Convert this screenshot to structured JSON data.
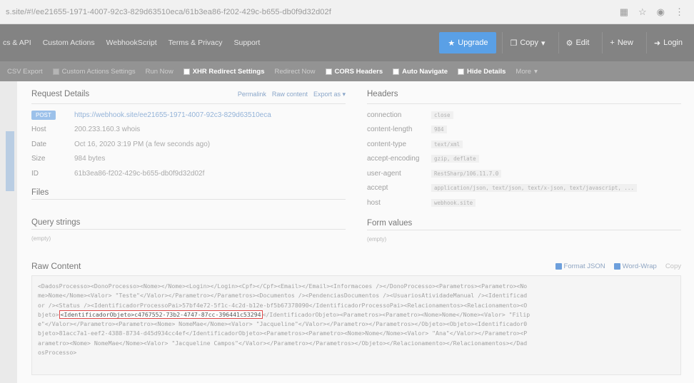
{
  "browser": {
    "url": "s.site/#!/ee21655-1971-4007-92c3-829d63510eca/61b3ea86-f202-429c-b655-db0f9d32d02f"
  },
  "topnav": {
    "links": [
      "cs & API",
      "Custom Actions",
      "WebhookScript",
      "Terms & Privacy",
      "Support"
    ],
    "upgrade_label": "Upgrade",
    "copy_label": "Copy",
    "edit_label": "Edit",
    "new_label": "New",
    "login_label": "Login"
  },
  "toolbar": {
    "items": [
      {
        "label": "CSV Export",
        "on": false
      },
      {
        "label": "Custom Actions Settings",
        "on": false
      },
      {
        "label": "Run Now",
        "on": false
      },
      {
        "label": "XHR Redirect Settings",
        "on": true
      },
      {
        "label": "Redirect Now",
        "on": false
      },
      {
        "label": "CORS Headers",
        "on": true
      },
      {
        "label": "Auto Navigate",
        "on": true
      },
      {
        "label": "Hide Details",
        "on": true
      },
      {
        "label": "More",
        "on": false
      }
    ]
  },
  "request_details": {
    "title": "Request Details",
    "permalink": "Permalink",
    "raw_content": "Raw content",
    "export_as": "Export as",
    "method": "POST",
    "url": "https://webhook.site/ee21655-1971-4007-92c3-829d63510eca",
    "host_label": "Host",
    "host_value": "200.233.160.3 whois",
    "date_label": "Date",
    "date_value": "Oct 16, 2020 3:19 PM (a few seconds ago)",
    "size_label": "Size",
    "size_value": "984 bytes",
    "id_label": "ID",
    "id_value": "61b3ea86-f202-429c-b655-db0f9d32d02f"
  },
  "files": {
    "title": "Files"
  },
  "query_strings": {
    "title": "Query strings",
    "empty": "(empty)"
  },
  "headers": {
    "title": "Headers",
    "rows": [
      {
        "key": "connection",
        "value": "close"
      },
      {
        "key": "content-length",
        "value": "984"
      },
      {
        "key": "content-type",
        "value": "text/xml"
      },
      {
        "key": "accept-encoding",
        "value": "gzip, deflate"
      },
      {
        "key": "user-agent",
        "value": "RestSharp/106.11.7.0"
      },
      {
        "key": "accept",
        "value": "application/json, text/json, text/x-json, text/javascript, ..."
      },
      {
        "key": "host",
        "value": "webhook.site"
      }
    ]
  },
  "form_values": {
    "title": "Form values",
    "empty": "(empty)"
  },
  "raw": {
    "title": "Raw Content",
    "format_json": "Format JSON",
    "word_wrap": "Word-Wrap",
    "copy": "Copy",
    "lines": [
      "<DadosProcesso><DonoProcesso><Nome></Nome><Login></Login><Cpf></Cpf><Email></Email><Informacoes /></DonoProcesso><Parametros><Parametro><No",
      "me>Nome</Nome><Valor> \"Teste\"</Valor></Parametro></Parametros><Documentos /><PendenciasDocumentos /><UsuariosAtividadeManual /><Identificad",
      "or /><Status /><IdentificadorProcessoPai>57bf4e72-5f1c-4c2d-b12e-bf5b67378090</IdentificadorProcessoPai><Relacionamentos><Relacionamento><O",
      "bjeto>",
      "e\"</Valor></Parametro><Parametro><Nome> NomeMae</Nome><Valor> \"Jacqueline\"</Valor></Parametro></Parametros></Objeto><Objeto><Identificador0",
      "bjeto>81acc7a1-eef2-4388-8734-d45d934cc4ef</IdentificadorObjeto><Parametros><Parametro><Nome>Nome</Nome><Valor> \"Ana\"</Valor></Parametro><P",
      "arametro><Nome> NomeMae</Nome><Valor> \"Jacqueline Campos\"</Valor></Parametro></Parametros></Objeto></Relacionamento></Relacionamentos></Dad",
      "osProcesso>"
    ],
    "highlight": "<IdentificadorObjeto>c4767552-73b2-4747-87cc-396441c53294",
    "highlight_after": "</IdentificadorObjeto><Parametros><Parametro><Nome>Nome</Nome><Valor> \"Filip"
  }
}
